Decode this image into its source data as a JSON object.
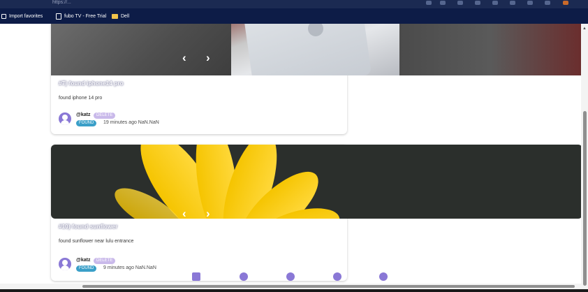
{
  "browser": {
    "url_text": "https://...",
    "favorites": [
      {
        "label": "Import favorites",
        "icon": "import-icon"
      },
      {
        "label": "fubo TV - Free Trial",
        "icon": "page-icon"
      },
      {
        "label": "Dell",
        "icon": "folder-icon"
      }
    ]
  },
  "posts": [
    {
      "title": "#7) found iphone14 pro",
      "description": "found iphone 14 pro",
      "user": "@katz",
      "delete_label": "DELETE",
      "status": "FOUND",
      "time": "19 minutes ago NaN.NaN",
      "prev": "‹",
      "next": "›"
    },
    {
      "title": "#10) found sunflower",
      "description": "found sunflower near lulu entrance",
      "user": "@katz",
      "delete_label": "DELETE",
      "status": "FOUND",
      "time": "9 minutes ago NaN.NaN",
      "prev": "‹",
      "next": "›"
    }
  ],
  "nav_icons": [
    "chat-icon",
    "compass-icon",
    "add-icon",
    "location-icon",
    "profile-icon"
  ],
  "colors": {
    "accent": "#8a78d6",
    "found": "#3a9fc8",
    "favbar": "#0d1c47"
  }
}
